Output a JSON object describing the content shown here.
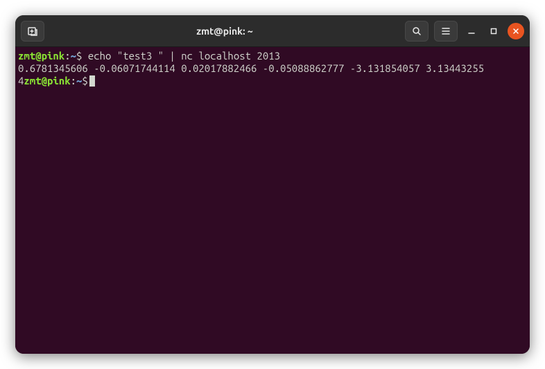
{
  "window": {
    "title": "zmt@pink: ~"
  },
  "terminal": {
    "lines": [
      {
        "type": "prompt_cmd",
        "user_host": "zmt@pink",
        "sep": ":",
        "path": "~",
        "symbol": "$",
        "command": " echo \"test3 \" | nc localhost 2013"
      },
      {
        "type": "output",
        "text": "0.6781345606 -0.06071744114 0.02017882466 -0.05088862777 -3.131854057 3.13443255"
      },
      {
        "type": "output_prompt",
        "prefix": "4",
        "user_host": "zmt@pink",
        "sep": ":",
        "path": "~",
        "symbol": "$"
      }
    ]
  }
}
